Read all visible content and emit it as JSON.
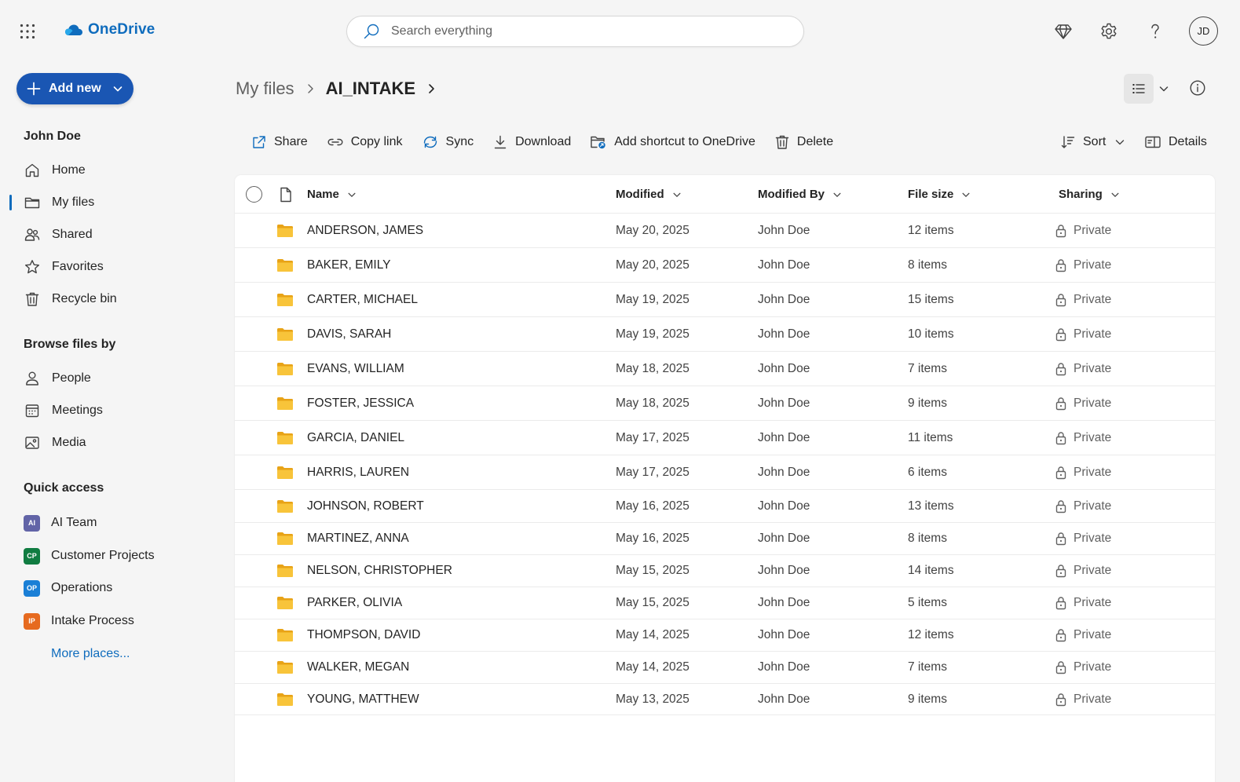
{
  "app": {
    "brand": "OneDrive",
    "accent": "#0f6cbd",
    "icons": [
      "waffle-icon",
      "onedrive-cloud-icon",
      "search-icon",
      "premium-diamond-icon",
      "settings-gear-icon",
      "help-icon"
    ]
  },
  "search": {
    "placeholder": "Search everything"
  },
  "user": {
    "initials": "JD",
    "name": "John Doe"
  },
  "sidebar": {
    "add_new_label": "Add new",
    "nav": [
      {
        "label": "Home",
        "icon": "home-icon"
      },
      {
        "label": "My files",
        "icon": "folder-icon",
        "active": true
      },
      {
        "label": "Shared",
        "icon": "people-icon"
      },
      {
        "label": "Favorites",
        "icon": "star-icon"
      },
      {
        "label": "Recycle bin",
        "icon": "trash-icon"
      }
    ],
    "browse_heading": "Browse files by",
    "browse": [
      {
        "label": "People",
        "icon": "person-icon"
      },
      {
        "label": "Meetings",
        "icon": "calendar-icon"
      },
      {
        "label": "Media",
        "icon": "image-icon"
      }
    ],
    "quick_access_heading": "Quick access",
    "quick_access": [
      {
        "label": "AI Team",
        "badge": "AI",
        "color": "#6264a7"
      },
      {
        "label": "Customer Projects",
        "badge": "CP",
        "color": "#107c41"
      },
      {
        "label": "Operations",
        "badge": "OP",
        "color": "#1a7fd6"
      },
      {
        "label": "Intake Process",
        "badge": "IP",
        "color": "#e66a1f"
      }
    ],
    "more_places": "More places..."
  },
  "breadcrumb": {
    "parent": "My files",
    "current": "AI_INTAKE"
  },
  "commands": {
    "share": "Share",
    "copy_link": "Copy link",
    "sync": "Sync",
    "download": "Download",
    "add_shortcut": "Add shortcut to OneDrive",
    "delete": "Delete",
    "sort": "Sort",
    "details": "Details"
  },
  "table": {
    "columns": {
      "name": "Name",
      "modified": "Modified",
      "modified_by": "Modified By",
      "file_size": "File size",
      "sharing": "Sharing"
    },
    "folder_color": "#f8c43a",
    "rows": [
      {
        "name": "ANDERSON, JAMES",
        "modified": "May 20, 2025",
        "by": "John Doe",
        "size": "12 items",
        "sharing": "Private"
      },
      {
        "name": "BAKER, EMILY",
        "modified": "May 20, 2025",
        "by": "John Doe",
        "size": "8 items",
        "sharing": "Private"
      },
      {
        "name": "CARTER, MICHAEL",
        "modified": "May 19, 2025",
        "by": "John Doe",
        "size": "15 items",
        "sharing": "Private"
      },
      {
        "name": "DAVIS, SARAH",
        "modified": "May 19, 2025",
        "by": "John Doe",
        "size": "10 items",
        "sharing": "Private"
      },
      {
        "name": "EVANS, WILLIAM",
        "modified": "May 18, 2025",
        "by": "John Doe",
        "size": "7 items",
        "sharing": "Private"
      },
      {
        "name": "FOSTER, JESSICA",
        "modified": "May 18, 2025",
        "by": "John Doe",
        "size": "9 items",
        "sharing": "Private"
      },
      {
        "name": "GARCIA, DANIEL",
        "modified": "May 17, 2025",
        "by": "John Doe",
        "size": "11 items",
        "sharing": "Private"
      },
      {
        "name": "HARRIS, LAUREN",
        "modified": "May 17, 2025",
        "by": "John Doe",
        "size": "6 items",
        "sharing": "Private"
      },
      {
        "name": "JOHNSON, ROBERT",
        "modified": "May 16, 2025",
        "by": "John Doe",
        "size": "13 items",
        "sharing": "Private"
      },
      {
        "name": "MARTINEZ, ANNA",
        "modified": "May 16, 2025",
        "by": "John Doe",
        "size": "8 items",
        "sharing": "Private"
      },
      {
        "name": "NELSON, CHRISTOPHER",
        "modified": "May 15, 2025",
        "by": "John Doe",
        "size": "14 items",
        "sharing": "Private"
      },
      {
        "name": "PARKER, OLIVIA",
        "modified": "May 15, 2025",
        "by": "John Doe",
        "size": "5 items",
        "sharing": "Private"
      },
      {
        "name": "THOMPSON, DAVID",
        "modified": "May 14, 2025",
        "by": "John Doe",
        "size": "12 items",
        "sharing": "Private"
      },
      {
        "name": "WALKER, MEGAN",
        "modified": "May 14, 2025",
        "by": "John Doe",
        "size": "7 items",
        "sharing": "Private"
      },
      {
        "name": "YOUNG, MATTHEW",
        "modified": "May 13, 2025",
        "by": "John Doe",
        "size": "9 items",
        "sharing": "Private"
      }
    ]
  }
}
